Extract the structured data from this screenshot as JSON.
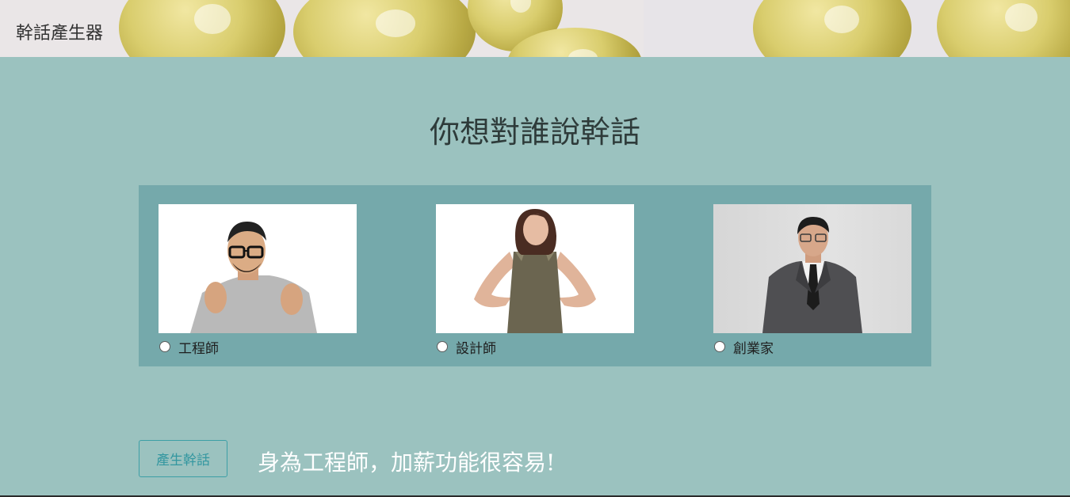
{
  "header": {
    "title": "幹話產生器"
  },
  "main": {
    "heading": "你想對誰說幹話"
  },
  "options": [
    {
      "label": "工程師",
      "selected": false
    },
    {
      "label": "設計師",
      "selected": false
    },
    {
      "label": "創業家",
      "selected": false
    }
  ],
  "actions": {
    "generate_label": "產生幹話"
  },
  "result": {
    "text": "身為工程師，加薪功能很容易!"
  },
  "colors": {
    "page_background": "#9bc2bf",
    "panel_background": "#75a9ab",
    "button_accent": "#3397a0",
    "result_text": "#ffffff"
  }
}
